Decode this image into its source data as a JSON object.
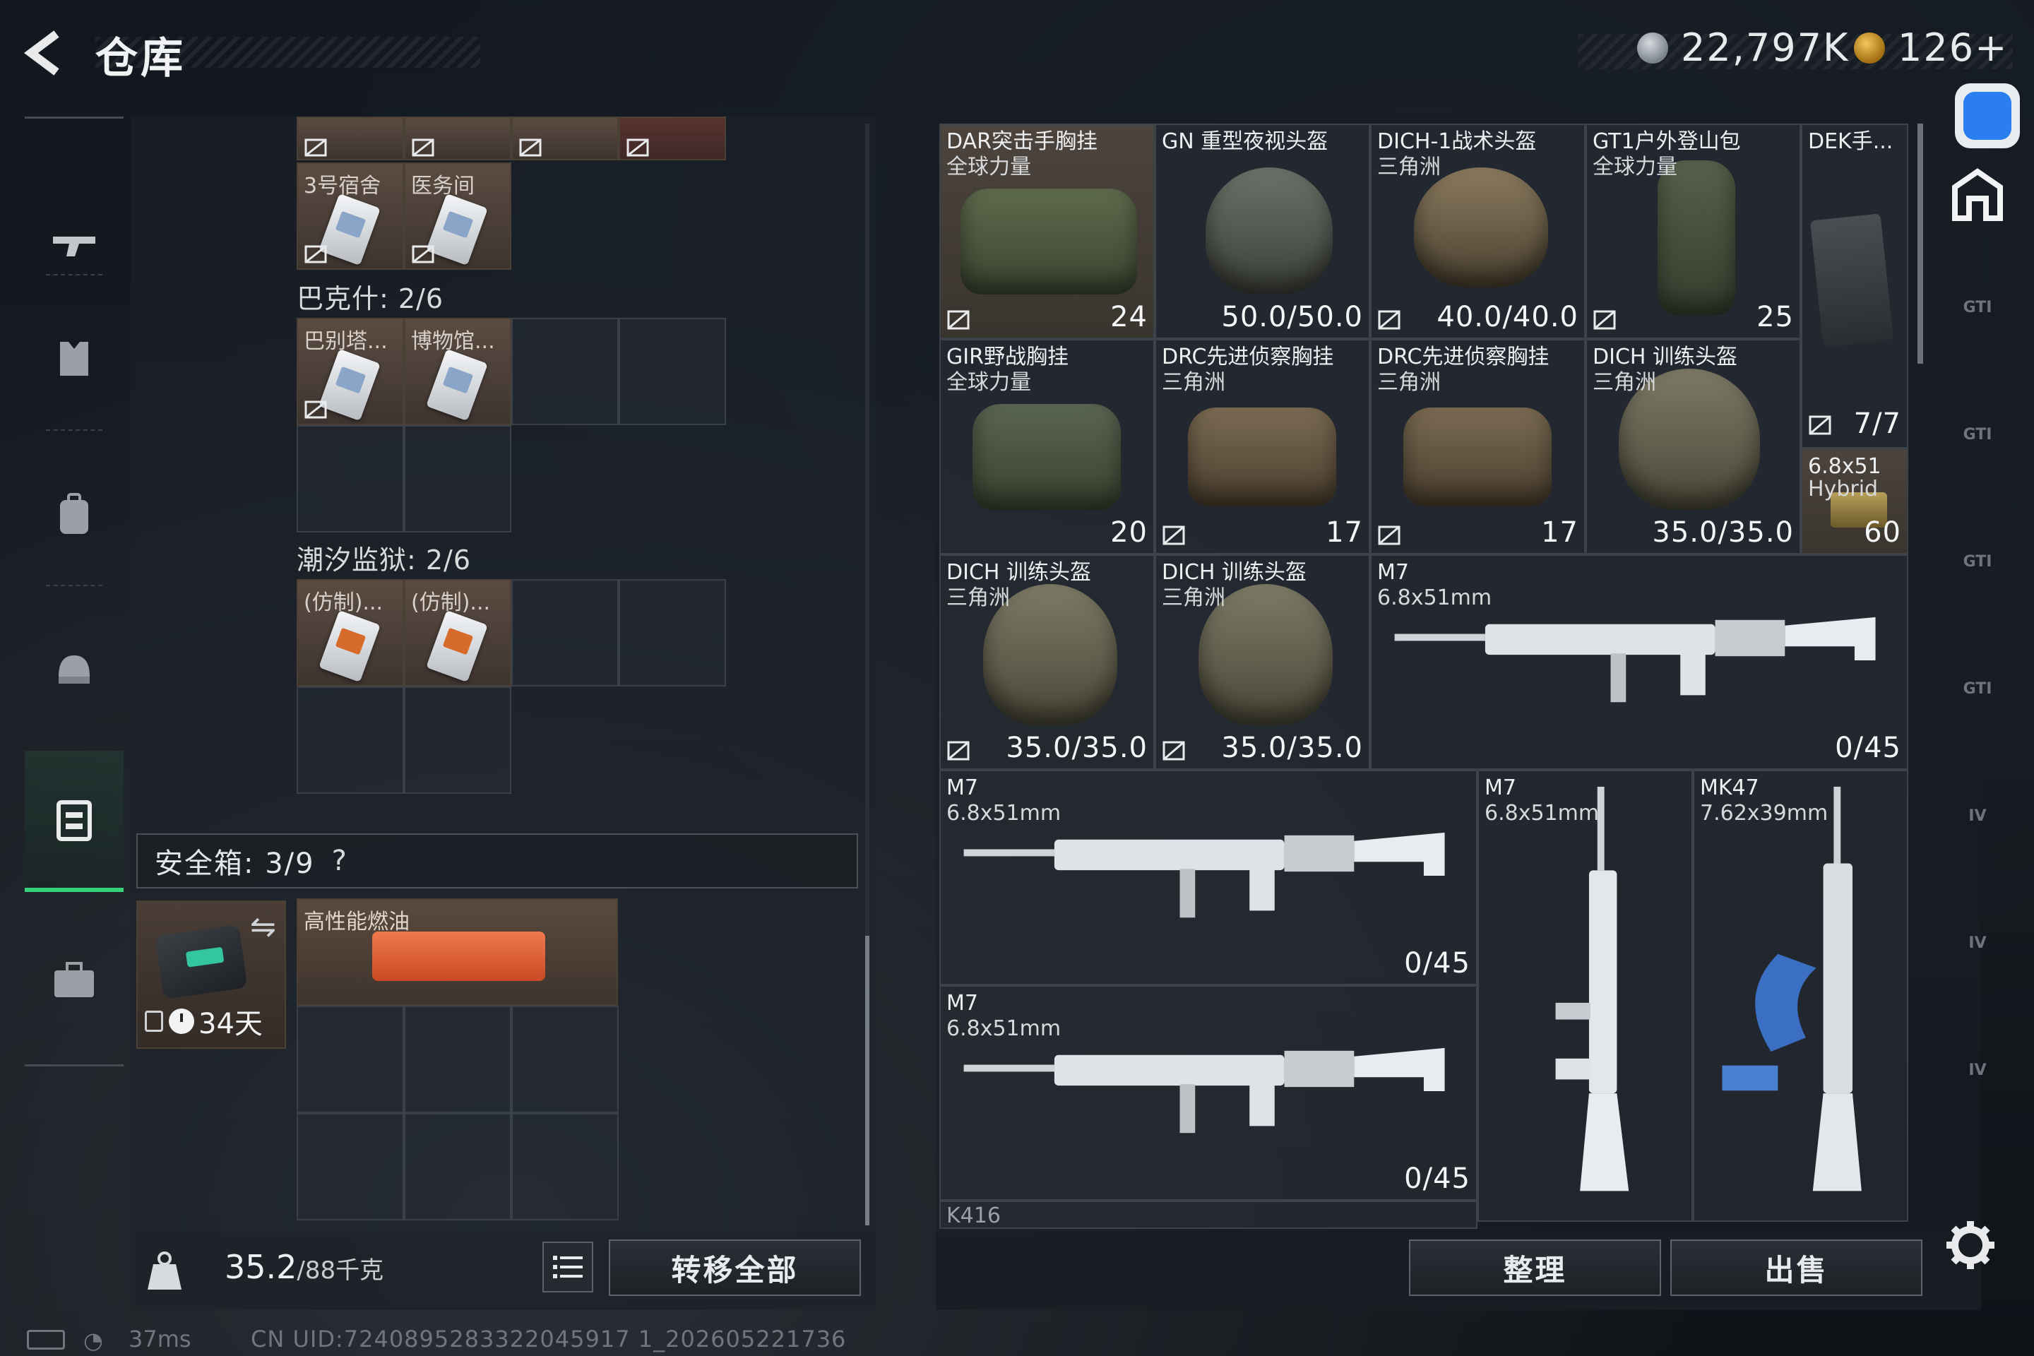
{
  "header": {
    "back_label": "<",
    "title": "仓库",
    "currency_silver": "22,797K",
    "currency_gold": "126+"
  },
  "nav": {
    "items": [
      {
        "name": "weapons"
      },
      {
        "name": "armor"
      },
      {
        "name": "backpack"
      },
      {
        "name": "rig"
      },
      {
        "name": "storage",
        "active": true
      },
      {
        "name": "case"
      }
    ]
  },
  "keys": {
    "top_partial": [
      "",
      "",
      "",
      ""
    ],
    "row1": [
      "3号宿舍",
      "医务间"
    ],
    "bakeshi_label": "巴克什: 2/6",
    "bakeshi": [
      "巴别塔...",
      "博物馆..."
    ],
    "tide_label": "潮汐监狱: 2/6",
    "tide": [
      "(仿制)...",
      "(仿制)..."
    ]
  },
  "safe": {
    "header": "安全箱: 3/9",
    "help": "?",
    "days": "34天",
    "swap_icon": "⇋",
    "fuel_label": "高性能燃油"
  },
  "footer_left": {
    "weight_value": "35.2",
    "weight_max": "/88千克",
    "transfer_label": "转移全部"
  },
  "storage": {
    "items": [
      {
        "name": "DAR突击手胸挂",
        "sub": "全球力量",
        "value": "24",
        "locked": true
      },
      {
        "name": "GN 重型夜视头盔",
        "sub": "",
        "value": "50.0/50.0",
        "locked": false
      },
      {
        "name": "DICH-1战术头盔",
        "sub": "三角洲",
        "value": "40.0/40.0",
        "locked": true
      },
      {
        "name": "GT1户外登山包",
        "sub": "全球力量",
        "value": "25",
        "locked": true
      },
      {
        "name": "DEK手...",
        "sub": "",
        "value": "7/7",
        "locked": true
      },
      {
        "name": "GIR野战胸挂",
        "sub": "全球力量",
        "value": "20",
        "locked": false
      },
      {
        "name": "DRC先进侦察胸挂",
        "sub": "三角洲",
        "value": "17",
        "locked": true
      },
      {
        "name": "DRC先进侦察胸挂",
        "sub": "三角洲",
        "value": "17",
        "locked": true
      },
      {
        "name": "DICH 训练头盔",
        "sub": "三角洲",
        "value": "35.0/35.0",
        "locked": false
      },
      {
        "name": "6.8x51",
        "sub": "Hybrid",
        "value": "60",
        "locked": false
      },
      {
        "name": "DICH 训练头盔",
        "sub": "三角洲",
        "value": "35.0/35.0",
        "locked": true
      },
      {
        "name": "DICH 训练头盔",
        "sub": "三角洲",
        "value": "35.0/35.0",
        "locked": true
      },
      {
        "name": "M7",
        "sub": "6.8x51mm",
        "value": "0/45",
        "locked": false
      },
      {
        "name": "M7",
        "sub": "6.8x51mm",
        "value": "0/45",
        "locked": false
      },
      {
        "name": "M7",
        "sub": "6.8x51mm",
        "value": "",
        "locked": false
      },
      {
        "name": "MK47",
        "sub": "7.62x39mm",
        "value": "",
        "locked": false
      },
      {
        "name": "M7",
        "sub": "6.8x51mm",
        "value": "0/45",
        "locked": false
      },
      {
        "name": "K416",
        "sub": "",
        "value": "",
        "locked": false
      }
    ]
  },
  "footer_right": {
    "sort_label": "整理",
    "sell_label": "出售"
  },
  "sidebar_right": {
    "tabs": [
      "GTI",
      "GTI",
      "GTI",
      "GTI",
      "IV",
      "IV",
      "IV"
    ]
  },
  "status": {
    "ping": "37ms",
    "uid": "CN UID:7240895283322045917 1_202605221736"
  },
  "colors": {
    "accent_green": "#36d27a",
    "item_orange_bg": "#4c443d",
    "access_blue": "#2a7ef0"
  }
}
